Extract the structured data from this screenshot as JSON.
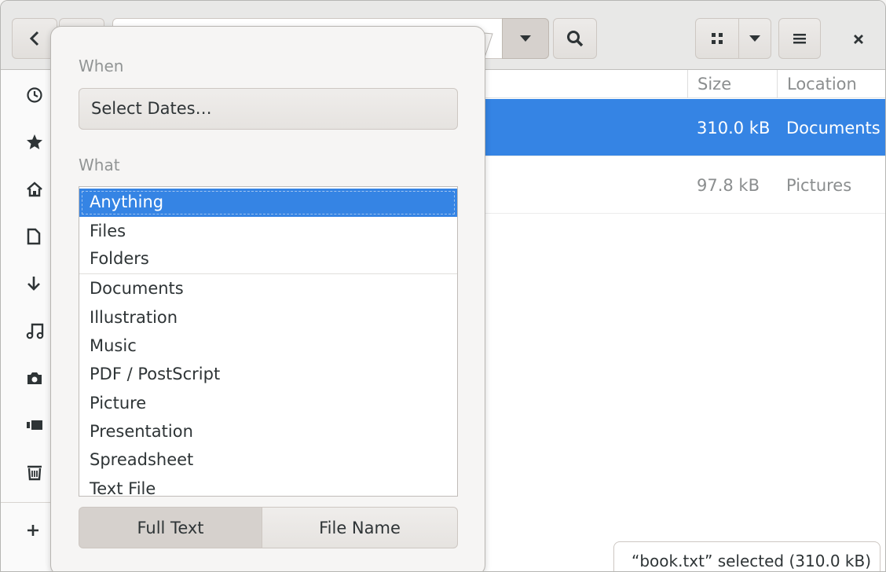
{
  "columns": {
    "size": "Size",
    "location": "Location"
  },
  "rows": [
    {
      "size": "310.0 kB",
      "location": "Documents",
      "selected": true
    },
    {
      "size": "97.8 kB",
      "location": "Pictures",
      "selected": false
    }
  ],
  "status": "“book.txt” selected  (310.0 kB)",
  "popover": {
    "when_label": "When",
    "dates_button": "Select Dates…",
    "what_label": "What",
    "what_items": [
      "Anything",
      "Files",
      "Folders",
      "Documents",
      "Illustration",
      "Music",
      "PDF / PostScript",
      "Picture",
      "Presentation",
      "Spreadsheet",
      "Text File"
    ],
    "search_full_text": "Full Text",
    "search_file_name": "File Name"
  },
  "sidebar_icons": [
    "recent-icon",
    "starred-icon",
    "home-icon",
    "document-icon",
    "download-icon",
    "music-icon",
    "camera-icon",
    "video-icon",
    "trash-icon",
    "add-icon"
  ],
  "colors": {
    "accent": "#3584e4",
    "headerbar": "#e8e8e7"
  }
}
